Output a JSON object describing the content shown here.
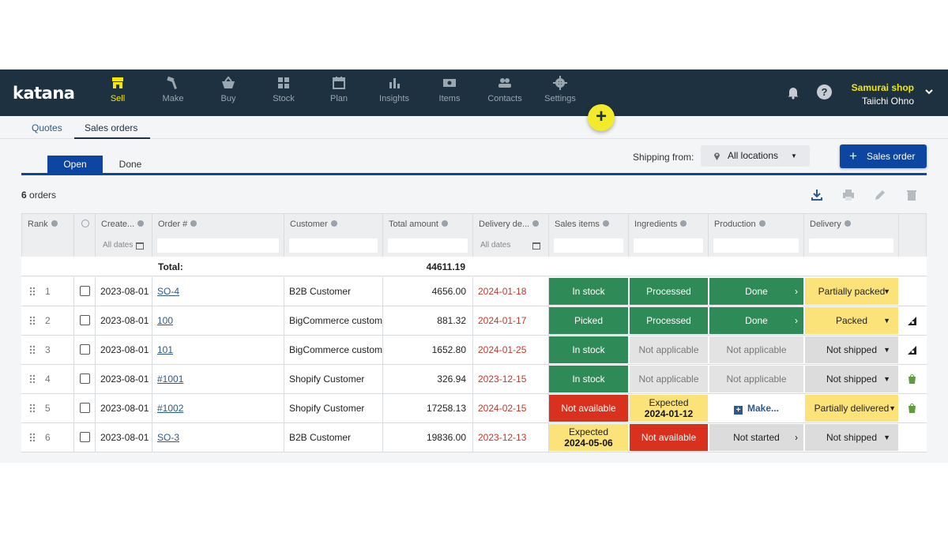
{
  "app": {
    "logo": "katana"
  },
  "nav": {
    "items": [
      {
        "label": "Sell",
        "icon": "storefront-icon"
      },
      {
        "label": "Make",
        "icon": "hammer-icon"
      },
      {
        "label": "Buy",
        "icon": "basket-icon"
      },
      {
        "label": "Stock",
        "icon": "boxes-icon"
      },
      {
        "label": "Plan",
        "icon": "calendar-icon"
      },
      {
        "label": "Insights",
        "icon": "bar-chart-icon"
      },
      {
        "label": "Items",
        "icon": "ticket-icon"
      },
      {
        "label": "Contacts",
        "icon": "people-icon"
      },
      {
        "label": "Settings",
        "icon": "gear-icon"
      }
    ],
    "active": "Sell",
    "fab": "+",
    "shop_name": "Samurai shop",
    "user_name": "Taiichi Ohno",
    "help": "?"
  },
  "subtabs": {
    "quotes": "Quotes",
    "sales_orders": "Sales orders"
  },
  "state_tabs": {
    "open": "Open",
    "done": "Done"
  },
  "shipping": {
    "label": "Shipping from:",
    "value": "All locations"
  },
  "new_order_button": "Sales order",
  "order_count": {
    "number": "6",
    "suffix": " orders"
  },
  "columns": {
    "rank": "Rank",
    "created": "Create...",
    "order": "Order #",
    "customer": "Customer",
    "total": "Total amount",
    "delivery_date": "Delivery de...",
    "sales_items": "Sales items",
    "ingredients": "Ingredients",
    "production": "Production",
    "delivery": "Delivery"
  },
  "filters": {
    "created": "All dates",
    "delivery_date": "All dates"
  },
  "totals": {
    "label": "Total:",
    "value": "44611.19"
  },
  "rows": [
    {
      "rank": "1",
      "created": "2023-08-01",
      "order": "SO-4",
      "customer": "B2B Customer",
      "total": "4656.00",
      "delivery": "2024-01-18",
      "sales": "In stock",
      "ingredients": "Processed",
      "production": "Done",
      "ship": "Partially packed"
    },
    {
      "rank": "2",
      "created": "2023-08-01",
      "order": "100",
      "customer": "BigCommerce custom",
      "total": "881.32",
      "delivery": "2024-01-17",
      "sales": "Picked",
      "ingredients": "Processed",
      "production": "Done",
      "ship": "Packed"
    },
    {
      "rank": "3",
      "created": "2023-08-01",
      "order": "101",
      "customer": "BigCommerce custom",
      "total": "1652.80",
      "delivery": "2024-01-25",
      "sales": "In stock",
      "ingredients": "Not applicable",
      "production": "Not applicable",
      "ship": "Not shipped"
    },
    {
      "rank": "4",
      "created": "2023-08-01",
      "order": "#1001",
      "customer": "Shopify Customer",
      "total": "326.94",
      "delivery": "2023-12-15",
      "sales": "In stock",
      "ingredients": "Not applicable",
      "production": "Not applicable",
      "ship": "Not shipped"
    },
    {
      "rank": "5",
      "created": "2023-08-01",
      "order": "#1002",
      "customer": "Shopify Customer",
      "total": "17258.13",
      "delivery": "2024-02-15",
      "sales": "Not available",
      "ingredients_top": "Expected",
      "ingredients_date": "2024-01-12",
      "production": "Make...",
      "ship": "Partially delivered"
    },
    {
      "rank": "6",
      "created": "2023-08-01",
      "order": "SO-3",
      "customer": "B2B Customer",
      "total": "19836.00",
      "delivery": "2023-12-13",
      "sales_top": "Expected",
      "sales_date": "2024-05-06",
      "ingredients": "Not available",
      "production": "Not started",
      "ship": "Not shipped"
    }
  ],
  "colors": {
    "nav_bg": "#1d3140",
    "accent": "#f5e800",
    "primary": "#0c46a0",
    "green": "#2e8b57",
    "yellow": "#fbe37a",
    "red": "#d8321f"
  }
}
